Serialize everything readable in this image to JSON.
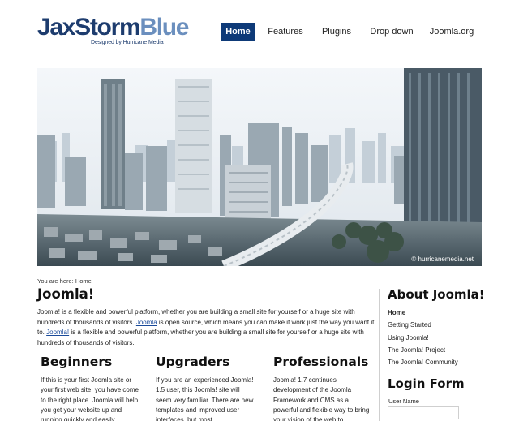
{
  "header": {
    "logo_part1": "JaxStorm",
    "logo_part2": "Blue",
    "logo_tagline": "Designed by Hurricane Media"
  },
  "nav": {
    "items": [
      {
        "label": "Home",
        "active": true
      },
      {
        "label": "Features",
        "active": false
      },
      {
        "label": "Plugins",
        "active": false
      },
      {
        "label": "Drop down",
        "active": false
      },
      {
        "label": "Joomla.org",
        "active": false
      }
    ]
  },
  "banner": {
    "credit": "© hurricanemedia.net"
  },
  "breadcrumb": "You are here: Home",
  "main": {
    "title": "Joomla!",
    "intro": {
      "p1": "Joomla! is a flexible and powerful platform, whether you are building a small site for yourself or a huge site with hundreds of thousands of visitors. ",
      "link1": "Joomla",
      "p2": " is open source, which means you can make it work just the way you want it to. ",
      "link2": "Joomla!",
      "p3": " is a flexible and powerful platform, whether you are building a small site for yourself or a huge site with hundreds of thousands of visitors."
    },
    "columns": [
      {
        "title": "Beginners",
        "text": "If this is your first Joomla site or your first web site, you have come to the right place. Joomla will help you get your website up and running quickly and easily."
      },
      {
        "title": "Upgraders",
        "text": "If you are an experienced Joomla! 1.5 user, this Joomla! site will seem very familiar. There are new templates and improved user interfaces, but most"
      },
      {
        "title": "Professionals",
        "text": "Joomla! 1.7 continues development of the Joomla Framework and CMS as a powerful and flexible way to bring your vision of the web to"
      }
    ]
  },
  "sidebar": {
    "about_title": "About Joomla!",
    "menu": [
      {
        "label": "Home",
        "current": true
      },
      {
        "label": "Getting Started",
        "current": false
      },
      {
        "label": "Using Joomla!",
        "current": false
      },
      {
        "label": "The Joomla! Project",
        "current": false
      },
      {
        "label": "The Joomla! Community",
        "current": false
      }
    ],
    "login_title": "Login Form",
    "username_label": "User Name",
    "username_value": ""
  },
  "colors": {
    "nav_active_bg": "#0e3a78",
    "logo_dark": "#1d3c6e",
    "logo_light": "#6b8fbe",
    "link": "#1a4a9a"
  }
}
